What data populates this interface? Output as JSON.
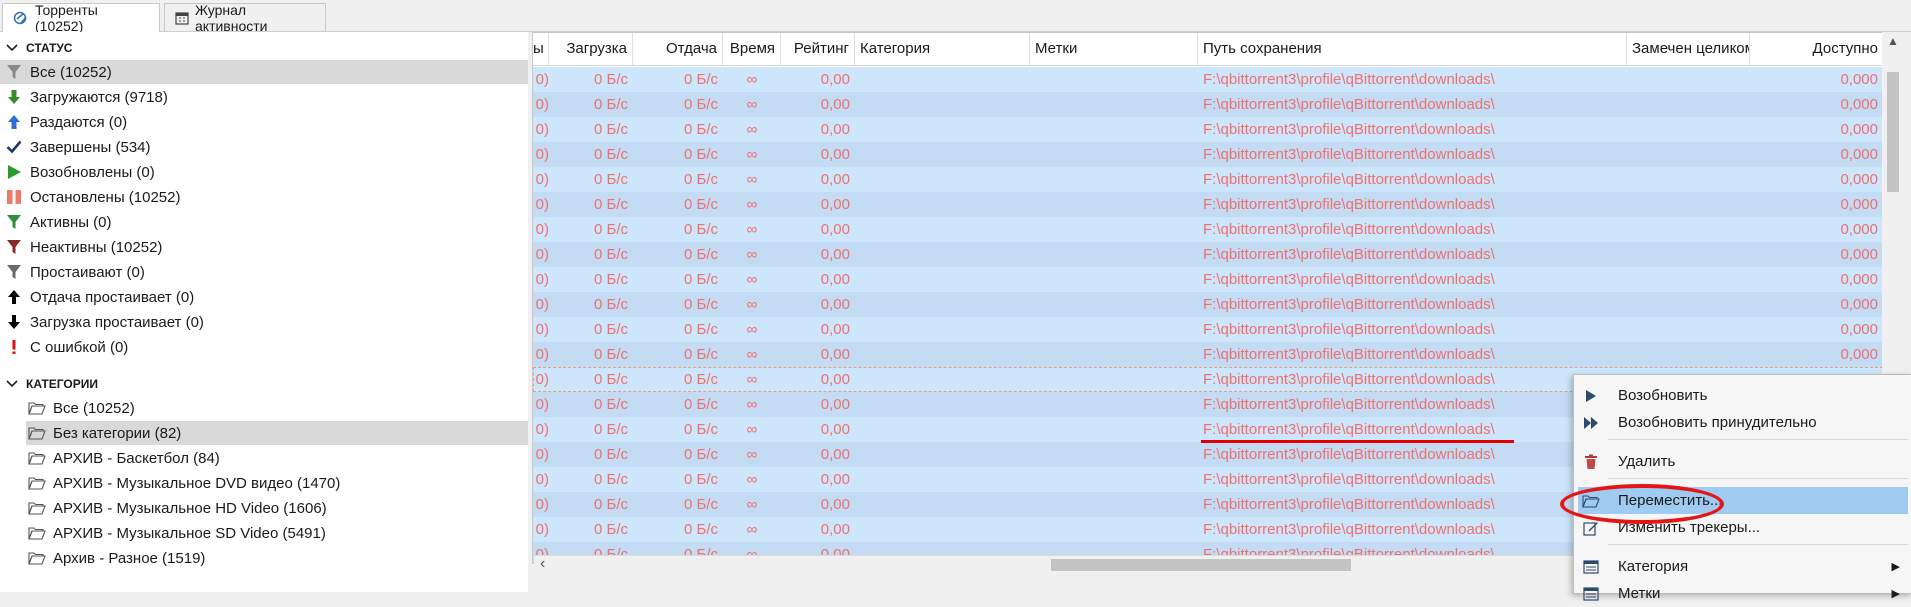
{
  "tabs": [
    {
      "label": "Торренты (10252)",
      "icon": "torrents-icon"
    },
    {
      "label": "Журнал активности",
      "icon": "calendar-icon"
    }
  ],
  "sidebar": {
    "status_header": "СТАТУС",
    "status_items": [
      {
        "label": "Все (10252)",
        "icon": "filter-icon",
        "color": "#8a8a8a"
      },
      {
        "label": "Загружаются (9718)",
        "icon": "arrow-down-icon",
        "color": "#3b8b2e"
      },
      {
        "label": "Раздаются (0)",
        "icon": "arrow-up-icon",
        "color": "#2f6fd1"
      },
      {
        "label": "Завершены (534)",
        "icon": "check-icon",
        "color": "#1f3a5f"
      },
      {
        "label": "Возобновлены (0)",
        "icon": "play-icon",
        "color": "#2a9a2a"
      },
      {
        "label": "Остановлены (10252)",
        "icon": "pause-icon",
        "color": "#f07a6a"
      },
      {
        "label": "Активны (0)",
        "icon": "filter-icon",
        "color": "#2f8f3f"
      },
      {
        "label": "Неактивны (10252)",
        "icon": "filter-icon",
        "color": "#8b2a2a"
      },
      {
        "label": "Простаивают (0)",
        "icon": "filter-icon",
        "color": "#6a6a6a"
      },
      {
        "label": "Отдача простаивает (0)",
        "icon": "arrow-up-icon",
        "color": "#000000"
      },
      {
        "label": "Загрузка простаивает (0)",
        "icon": "arrow-down-icon",
        "color": "#000000"
      },
      {
        "label": "С ошибкой (0)",
        "icon": "exclamation-icon",
        "color": "#e01010"
      }
    ],
    "categories_header": "КАТЕГОРИИ",
    "category_items": [
      {
        "label": "Все (10252)"
      },
      {
        "label": "Без категории (82)"
      },
      {
        "label": "АРХИВ - Баскетбол (84)"
      },
      {
        "label": "АРХИВ - Музыкальное DVD видео (1470)"
      },
      {
        "label": "АРХИВ - Музыкальное HD Video (1606)"
      },
      {
        "label": "АРХИВ - Музыкальное SD Video (5491)"
      },
      {
        "label": "Архив - Разное (1519)"
      }
    ]
  },
  "table": {
    "columns": [
      {
        "label": "ы"
      },
      {
        "label": "Загрузка"
      },
      {
        "label": "Отдача"
      },
      {
        "label": "Время"
      },
      {
        "label": "Рейтинг"
      },
      {
        "label": "Категория"
      },
      {
        "label": "Метки"
      },
      {
        "label": "Путь сохранения"
      },
      {
        "label": "Замечен целиком"
      },
      {
        "label": "Доступно"
      }
    ],
    "row_values": {
      "first": "0)",
      "download": "0 Б/с",
      "upload": "0 Б/с",
      "eta": "∞",
      "ratio": "0,00",
      "category": "",
      "tags": "",
      "path": "F:\\qbittorrent3\\profile\\qBittorrent\\downloads\\",
      "seen_complete": "",
      "availability": "0,000"
    }
  },
  "context_menu": {
    "items": [
      {
        "label": "Возобновить",
        "icon": "play-icon"
      },
      {
        "label": "Возобновить принудительно",
        "icon": "fast-forward-icon"
      },
      {
        "label": "Удалить",
        "icon": "trash-icon"
      },
      {
        "label": "Переместить...",
        "icon": "folder-open-icon"
      },
      {
        "label": "Изменить трекеры...",
        "icon": "edit-icon"
      },
      {
        "label": "Категория",
        "icon": "list-icon"
      },
      {
        "label": "Метки",
        "icon": "list-icon"
      }
    ]
  },
  "colors": {
    "row_text": "#f07070",
    "row_bg_a": "#cde6fb",
    "row_bg_b": "#c3dcf3",
    "selection": "#d9d9d9",
    "menu_highlight": "#9fcbf1",
    "annotation_red": "#e41515"
  }
}
